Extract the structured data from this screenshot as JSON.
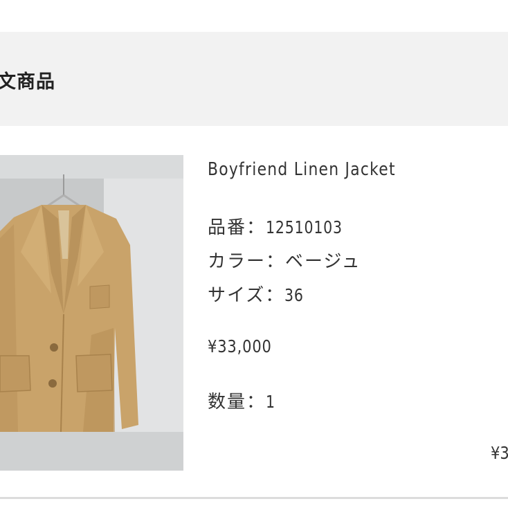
{
  "section": {
    "title": "文商品"
  },
  "product": {
    "name": "Boyfriend Linen Jacket",
    "image_alt": "beige linen jacket on hanger",
    "specs": [
      {
        "label": "品番：",
        "value": "12510103"
      },
      {
        "label": "カラー：",
        "value": "ベージュ"
      },
      {
        "label": "サイズ：",
        "value": "36"
      }
    ],
    "price": "¥33,000",
    "quantity_label": "数量：",
    "quantity_value": "1",
    "subtotal": "¥3"
  },
  "colors": {
    "header_bg": "#f2f2f2",
    "jacket": "#c9a36a",
    "text": "#333333"
  }
}
